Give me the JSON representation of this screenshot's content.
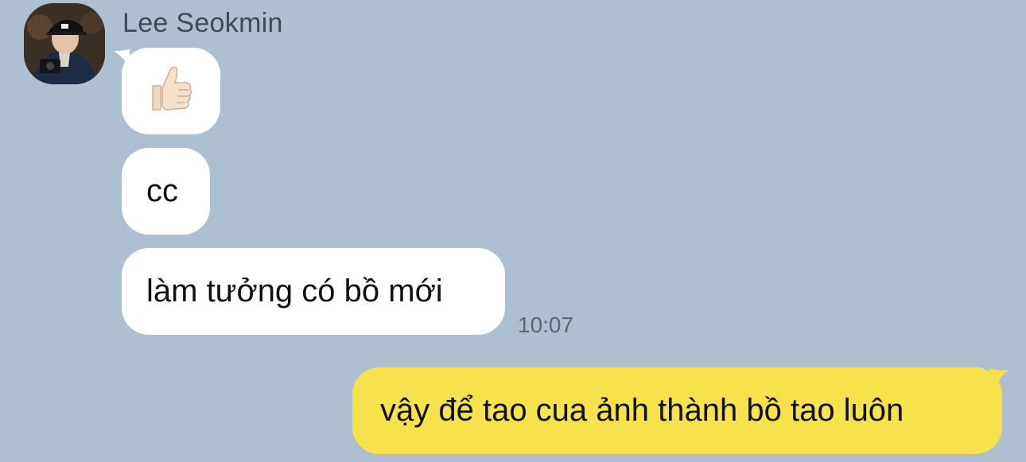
{
  "sender": {
    "name": "Lee Seokmin"
  },
  "incoming_messages": [
    {
      "kind": "emoji",
      "icon": "thumbs-up-icon"
    },
    {
      "kind": "text",
      "text": "cc"
    },
    {
      "kind": "text",
      "text": "làm tưởng có bồ mới"
    }
  ],
  "incoming_time": "10:07",
  "outgoing_messages": [
    {
      "kind": "text",
      "text": "vậy để tao cua ảnh thành bồ tao luôn"
    }
  ],
  "colors": {
    "background": "#aec0d0",
    "incoming_bubble": "#ffffff",
    "outgoing_bubble": "#f7e14d"
  }
}
